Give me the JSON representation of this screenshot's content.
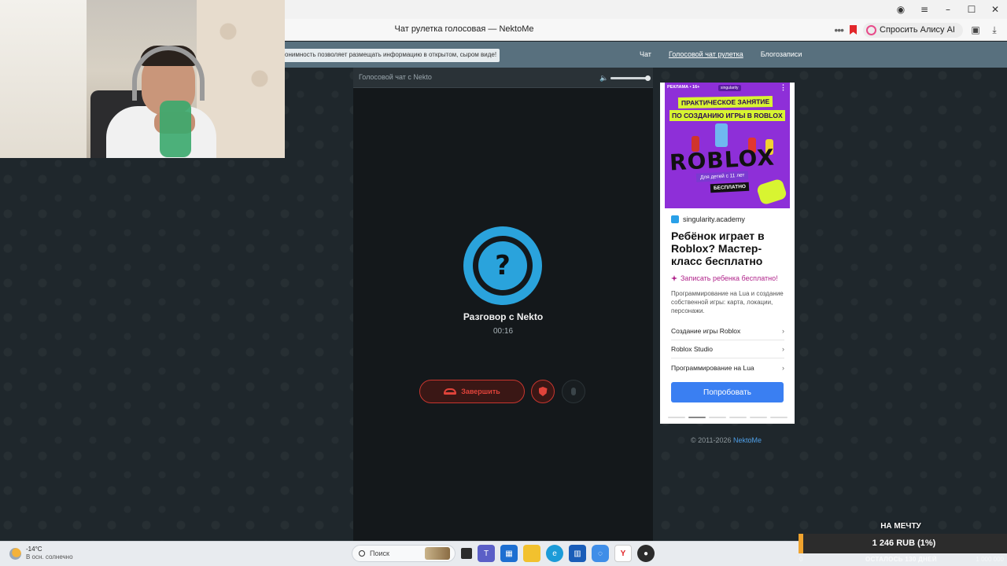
{
  "browser": {
    "page_title": "Чат рулетка голосовая — NektoMe",
    "alice_button": "Спросить Алису AI",
    "window_buttons": [
      "–",
      "☐",
      "✕"
    ]
  },
  "site": {
    "notice": "онимность позволяет размещать информацию в открытом, сыром виде!",
    "nav": [
      {
        "label": "Чат",
        "active": false
      },
      {
        "label": "Голосовой чат рулетка",
        "active": true
      },
      {
        "label": "Блогозаписи",
        "active": false
      }
    ]
  },
  "chat": {
    "header_title": "Голосовой чат с Nekto",
    "volume_level": 1.0,
    "avatar_glyph": "?",
    "conversation_title": "Разговор с Nekto",
    "timer": "00:16",
    "end_button": "Завершить",
    "colors": {
      "accent": "#2aa3dc",
      "danger": "#e0433a"
    }
  },
  "ad": {
    "label": "РЕКЛАМА • 16+",
    "brand": "singularity",
    "headline_banner_1": "ПРАКТИЧЕСКОЕ ЗАНЯТИЕ",
    "headline_banner_2": "ПО СОЗДАНИЮ ИГРЫ В ROBLOX",
    "roblox": "ROBLOX",
    "age_note": "Для детей с 11 лет",
    "free_note": "БЕСПЛАТНО",
    "site": "singularity.academy",
    "headline": "Ребёнок играет в Roblox? Мастер-класс бесплатно",
    "cta_link": "Записать ребенка бесплатно!",
    "description": "Программирование на Lua и создание собственной игры: карта, локации, персонажи.",
    "items": [
      "Создание игры Roblox",
      "Roblox Studio",
      "Программирование на Lua"
    ],
    "try_button": "Попробовать",
    "carousel_active_index": 1
  },
  "footer": {
    "copyright": "© 2011-2026 ",
    "brand_link": "NektoMe"
  },
  "taskbar": {
    "temperature": "-14°C",
    "weather_desc": "В осн. солнечно",
    "search_placeholder": "Поиск"
  },
  "donation": {
    "title": "НА МЕЧТУ",
    "amount": "1 246 RUB (1%)",
    "progress": 0.01,
    "remaining": "ОСТАЛОСЬ 130 ДНЕЙ",
    "min": "0",
    "max": "1 000 000"
  }
}
